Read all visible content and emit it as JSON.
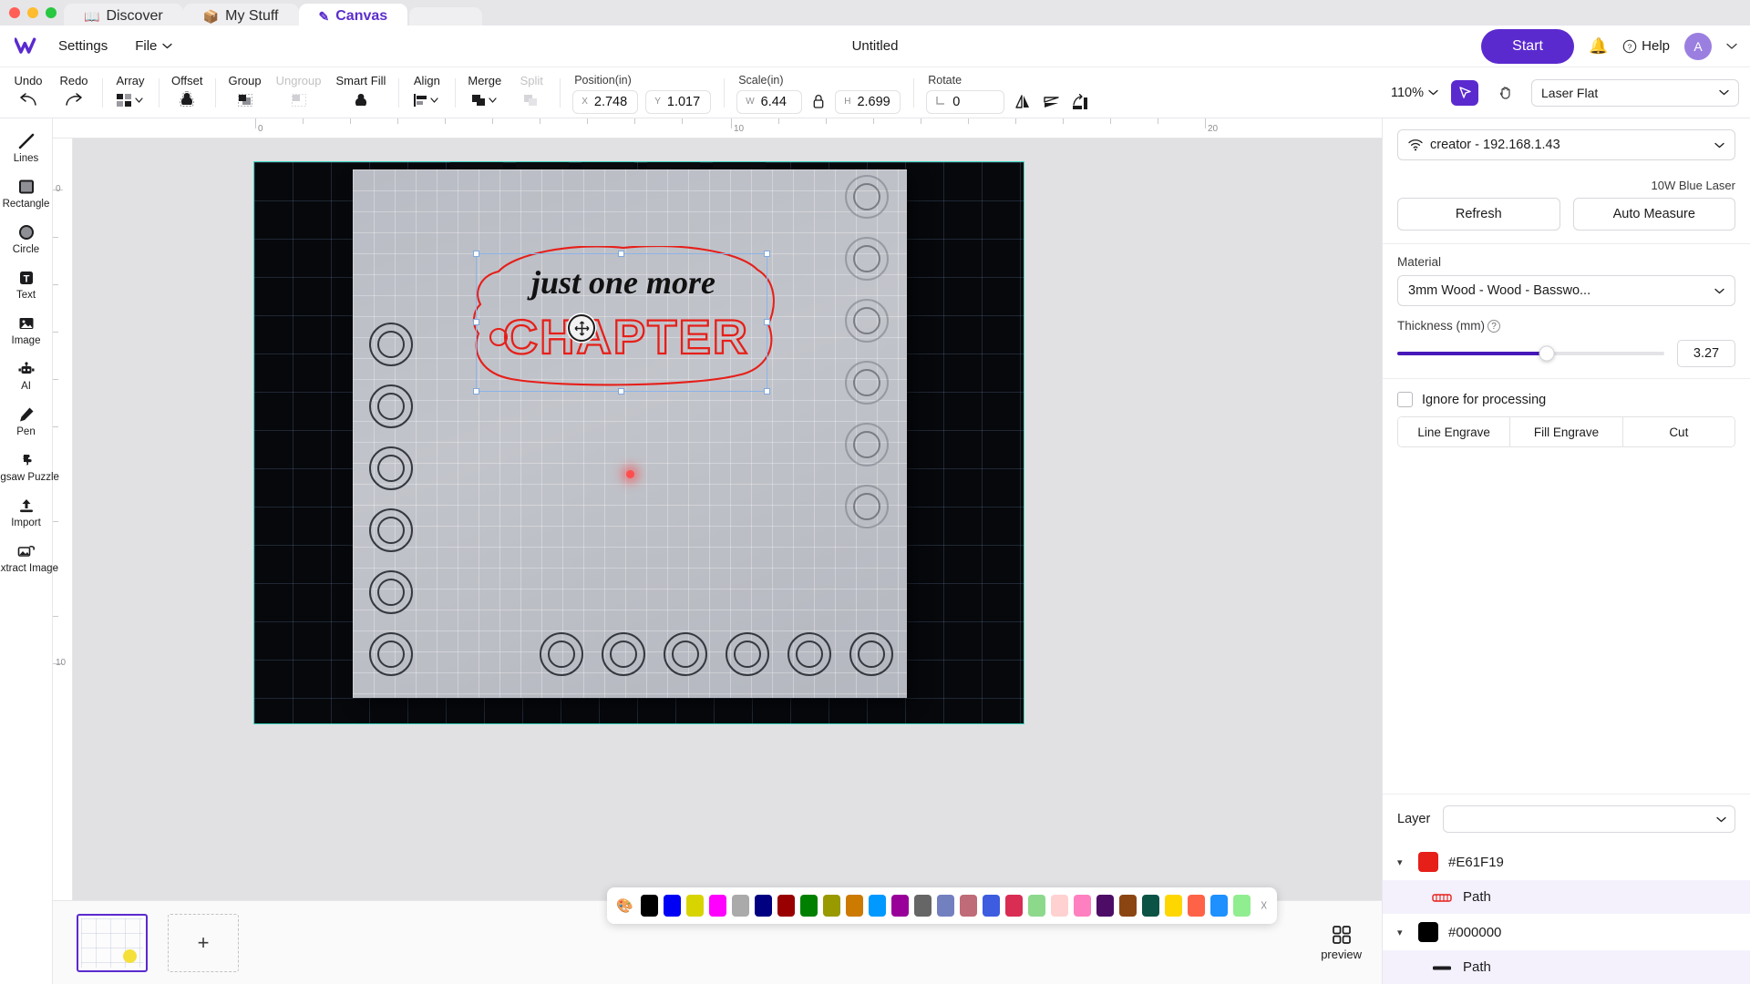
{
  "browser": {
    "tabs": [
      {
        "label": "Discover",
        "icon": "book-icon",
        "active": false
      },
      {
        "label": "My Stuff",
        "icon": "archive-icon",
        "active": false
      },
      {
        "label": "Canvas",
        "icon": "pen-canvas-icon",
        "active": true
      }
    ]
  },
  "header": {
    "menu": [
      {
        "label": "Settings",
        "has_caret": false
      },
      {
        "label": "File",
        "has_caret": true
      }
    ],
    "document_title": "Untitled",
    "start_label": "Start",
    "help_label": "Help",
    "avatar_initial": "A"
  },
  "toolbar": {
    "history": [
      {
        "label": "Undo",
        "icon": "undo-arrow-icon",
        "disabled": false
      },
      {
        "label": "Redo",
        "icon": "redo-arrow-icon",
        "disabled": false
      }
    ],
    "actions": [
      {
        "label": "Array",
        "icon": "array-grid-icon",
        "disabled": false,
        "caret": true
      },
      {
        "label": "Offset",
        "icon": "offset-icon",
        "disabled": false,
        "caret": false
      },
      {
        "label": "Group",
        "icon": "group-icon",
        "disabled": false,
        "caret": false
      },
      {
        "label": "Ungroup",
        "icon": "ungroup-icon",
        "disabled": true,
        "caret": false
      },
      {
        "label": "Smart Fill",
        "icon": "smart-fill-icon",
        "disabled": false,
        "caret": false
      },
      {
        "label": "Align",
        "icon": "align-icon",
        "disabled": false,
        "caret": true
      },
      {
        "label": "Merge",
        "icon": "merge-icon",
        "disabled": false,
        "caret": true
      },
      {
        "label": "Split",
        "icon": "split-icon",
        "disabled": true,
        "caret": false
      }
    ],
    "position": {
      "label": "Position(in)",
      "x_key": "X",
      "x_value": "2.748",
      "y_key": "Y",
      "y_value": "1.017"
    },
    "scale": {
      "label": "Scale(in)",
      "w_key": "W",
      "w_value": "6.44",
      "h_key": "H",
      "h_value": "2.699",
      "lock_icon": "lock-icon"
    },
    "rotate": {
      "label": "Rotate",
      "angle_key": "angle-icon",
      "angle_value": "0",
      "flip_horizontal_icon": "flip-horizontal-icon",
      "flip_vertical_icon": "flip-vertical-icon",
      "align-to-edge_icon": "align-edge-icon"
    },
    "zoom_level": "110%",
    "select_tool_icon": "cursor-select-icon",
    "pan_tool_icon": "hand-pan-icon",
    "device_mode": "Laser Flat"
  },
  "left_rail": [
    {
      "label": "Lines",
      "icon": "line-tool-icon"
    },
    {
      "label": "Rectangle",
      "icon": "rectangle-tool-icon"
    },
    {
      "label": "Circle",
      "icon": "circle-tool-icon"
    },
    {
      "label": "Text",
      "icon": "text-tool-icon"
    },
    {
      "label": "Image",
      "icon": "image-tool-icon"
    },
    {
      "label": "AI",
      "icon": "ai-robot-icon"
    },
    {
      "label": "Pen",
      "icon": "pen-tool-icon"
    },
    {
      "label": "Jigsaw Puzzle",
      "icon": "jigsaw-puzzle-icon"
    },
    {
      "label": "Import",
      "icon": "import-upload-icon"
    },
    {
      "label": "Extract Image",
      "icon": "extract-image-icon"
    }
  ],
  "canvas": {
    "ruler_h_labels": [
      "0",
      "10",
      "20"
    ],
    "ruler_v_labels": [
      "0",
      "10"
    ],
    "artwork": {
      "script_text": "just one more",
      "block_text": "CHAPTER",
      "outline_color": "#E61F19",
      "text_color": "#111111"
    },
    "cursor_icon": "move-crosshair-icon",
    "laser_dot": "laser-pointer-dot"
  },
  "palette": {
    "picker_icon": "color-palette-icon",
    "close_icon": "close-circle-icon",
    "swatches": [
      "#000000",
      "#0000F5",
      "#D8D400",
      "#FF00FF",
      "#AAAAAA",
      "#000080",
      "#990000",
      "#008000",
      "#999900",
      "#CC7A00",
      "#0099FF",
      "#990099",
      "#666666",
      "#7380BF",
      "#BF6B78",
      "#3D5CE0",
      "#D92D54",
      "#8CD98C",
      "#FFD1D1",
      "#FF80C0",
      "#4D0D66",
      "#8B4513",
      "#0B5345",
      "#FFD700",
      "#FF6347",
      "#1E90FF",
      "#90EE90"
    ]
  },
  "bottom": {
    "add_page_label": "+",
    "preview_label": "preview",
    "preview_icon": "preview-grid-icon"
  },
  "right_panel": {
    "device": {
      "wifi_icon": "wifi-icon",
      "name": "creator - 192.168.1.43",
      "laser_type": "10W Blue Laser",
      "refresh_label": "Refresh",
      "auto_measure_label": "Auto Measure"
    },
    "material": {
      "section_label": "Material",
      "selected": "3mm Wood - Wood - Basswo...",
      "thickness_label": "Thickness (mm)",
      "thickness_help_icon": "question-mark-icon",
      "thickness_value": "3.27",
      "slider_percent": 56
    },
    "processing": {
      "ignore_label": "Ignore for processing",
      "ignore_checked": false,
      "modes": [
        "Line Engrave",
        "Fill Engrave",
        "Cut"
      ]
    },
    "layers": {
      "header_label": "Layer",
      "groups": [
        {
          "color": "#E61F19",
          "hex_label": "#E61F19",
          "expanded": true,
          "children": [
            {
              "label": "Path",
              "icon": "path-red-icon",
              "selected": true
            }
          ]
        },
        {
          "color": "#000000",
          "hex_label": "#000000",
          "expanded": true,
          "children": [
            {
              "label": "Path",
              "icon": "path-black-icon",
              "selected": true
            }
          ]
        }
      ]
    }
  }
}
